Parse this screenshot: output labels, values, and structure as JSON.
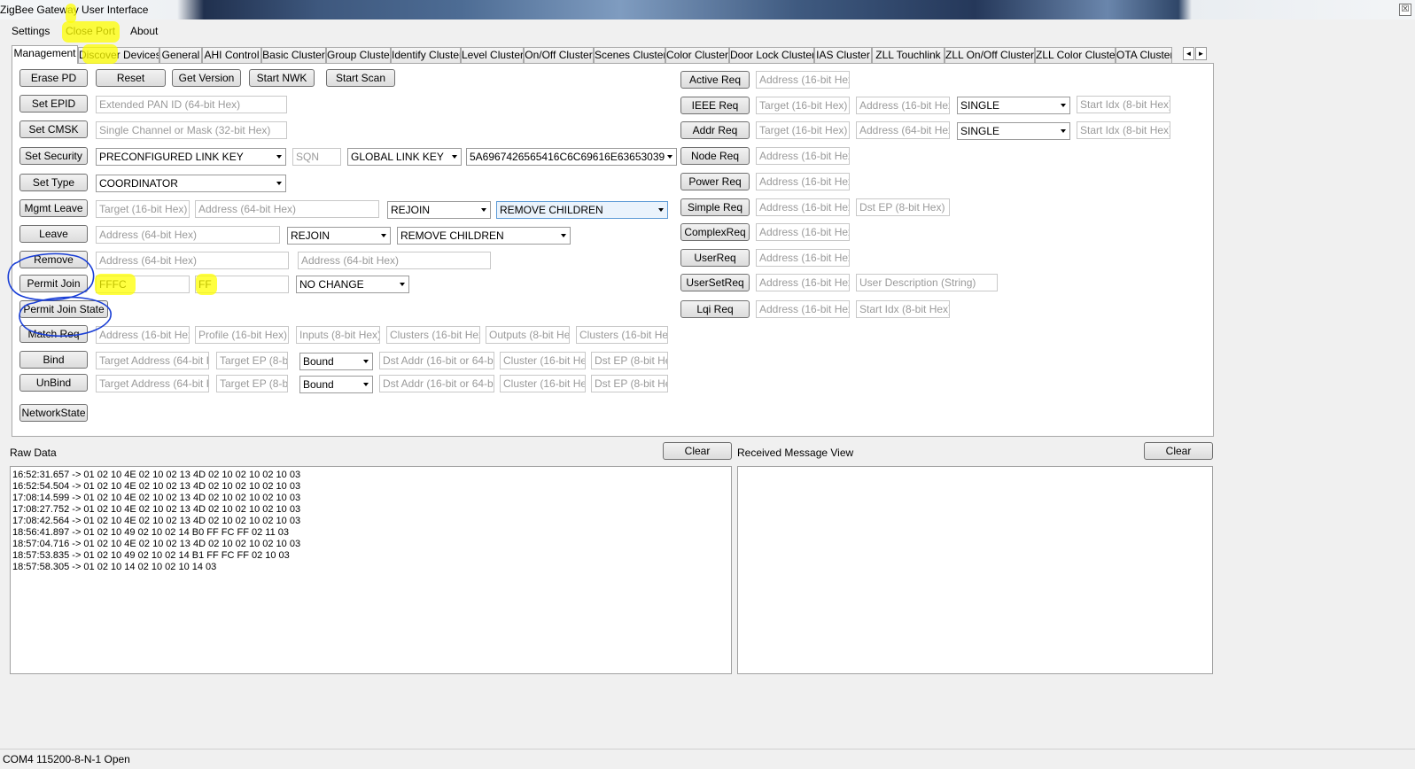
{
  "window": {
    "title": "ZigBee Gateway User Interface",
    "close_glyph": "☒"
  },
  "menu": {
    "items": [
      "Settings",
      "Close Port",
      "About"
    ]
  },
  "tabs": {
    "items": [
      "Management",
      "Discover Devices",
      "General",
      "AHI Control",
      "Basic Cluster",
      "Group Cluster",
      "Identify Cluster",
      "Level Cluster",
      "On/Off Cluster",
      "Scenes Cluster",
      "Color Cluster",
      "Door Lock Cluster",
      "IAS Cluster",
      "ZLL Touchlink",
      "ZLL On/Off Cluster",
      "ZLL Color Cluster",
      "OTA Cluster"
    ],
    "active": "Management",
    "scroll_left": "◄",
    "scroll_right": "►"
  },
  "left": {
    "erase_pd": "Erase PD",
    "reset": "Reset",
    "get_version": "Get Version",
    "start_nwk": "Start NWK",
    "start_scan": "Start Scan",
    "set_epid": "Set EPID",
    "epid_placeholder": "Extended PAN ID (64-bit Hex)",
    "set_cmsk": "Set CMSK",
    "cmsk_placeholder": "Single Channel or Mask (32-bit Hex)",
    "set_security": "Set Security",
    "security_type": "PRECONFIGURED LINK KEY",
    "sqn_placeholder": "SQN",
    "key_type": "GLOBAL LINK KEY",
    "key_value": "5A6967426565416C6C69616E63653039",
    "set_type": "Set Type",
    "device_type": "COORDINATOR",
    "mgmt_leave": "Mgmt Leave",
    "mgmt_leave_target": "Target (16-bit Hex)",
    "mgmt_leave_address": "Address (64-bit Hex)",
    "mgmt_leave_rejoin": "REJOIN",
    "mgmt_leave_children": "REMOVE CHILDREN",
    "leave": "Leave",
    "leave_address": "Address (64-bit Hex)",
    "leave_rejoin": "REJOIN",
    "leave_children": "REMOVE CHILDREN",
    "remove": "Remove",
    "remove_address1": "Address (64-bit Hex)",
    "remove_address2": "Address (64-bit Hex)",
    "permit_join": "Permit Join",
    "permit_join_target": "FFFC",
    "permit_join_duration": "FF",
    "permit_join_tc": "NO CHANGE",
    "permit_join_state": "Permit Join State",
    "match_req": "Match Req",
    "match_address": "Address (16-bit Hex)",
    "match_profile": "Profile (16-bit Hex)",
    "match_inputs": "Inputs (8-bit Hex)",
    "match_in_clusters": "Clusters (16-bit Hex)",
    "match_outputs": "Outputs (8-bit Hex)",
    "match_out_clusters": "Clusters (16-bit Hex)",
    "bind": "Bind",
    "bind_target": "Target Address (64-bit Hex)",
    "bind_target_ep": "Target EP (8-bit",
    "bind_mode": "Bound",
    "bind_dst": "Dst Addr (16-bit or 64-bit He",
    "bind_cluster": "Cluster (16-bit Hex)",
    "bind_dst_ep": "Dst EP (8-bit Hex)",
    "unbind": "UnBind",
    "unbind_target": "Target Address (64-bit Hex)",
    "unbind_target_ep": "Target EP (8-bit",
    "unbind_mode": "Bound",
    "unbind_dst": "Dst Addr (16-bit or 64-bit He",
    "unbind_cluster": "Cluster (16-bit Hex)",
    "unbind_dst_ep": "Dst EP (8-bit Hex)",
    "network_state": "NetworkState"
  },
  "right": {
    "active_req": "Active Req",
    "active_address": "Address (16-bit Hex)",
    "ieee_req": "IEEE Req",
    "ieee_target": "Target (16-bit Hex)",
    "ieee_address": "Address (16-bit Hex)",
    "ieee_mode": "SINGLE",
    "ieee_start": "Start Idx (8-bit Hex)",
    "addr_req": "Addr Req",
    "addr_target": "Target (16-bit Hex)",
    "addr_address": "Address (64-bit Hex)",
    "addr_mode": "SINGLE",
    "addr_start": "Start Idx (8-bit Hex)",
    "node_req": "Node Req",
    "node_address": "Address (16-bit Hex)",
    "power_req": "Power Req",
    "power_address": "Address (16-bit Hex)",
    "simple_req": "Simple Req",
    "simple_address": "Address (16-bit Hex)",
    "simple_dst_ep": "Dst EP (8-bit Hex)",
    "complex_req": "ComplexReq",
    "complex_address": "Address (16-bit Hex)",
    "user_req": "UserReq",
    "user_address": "Address (16-bit Hex)",
    "user_set_req": "UserSetReq",
    "user_set_address": "Address (16-bit Hex)",
    "user_set_desc": "User Description (String)",
    "lqi_req": "Lqi Req",
    "lqi_address": "Address (16-bit Hex)",
    "lqi_start": "Start Idx (8-bit Hex)"
  },
  "raw": {
    "label": "Raw Data",
    "clear": "Clear",
    "lines": [
      "16:52:31.657 -> 01 02 10 4E 02 10 02 13 4D 02 10 02 10 02 10 03",
      "16:52:54.504 -> 01 02 10 4E 02 10 02 13 4D 02 10 02 10 02 10 03",
      "17:08:14.599 -> 01 02 10 4E 02 10 02 13 4D 02 10 02 10 02 10 03",
      "17:08:27.752 -> 01 02 10 4E 02 10 02 13 4D 02 10 02 10 02 10 03",
      "17:08:42.564 -> 01 02 10 4E 02 10 02 13 4D 02 10 02 10 02 10 03",
      "18:56:41.897 -> 01 02 10 49 02 10 02 14 B0 FF FC FF 02 11 03",
      "18:57:04.716 -> 01 02 10 4E 02 10 02 13 4D 02 10 02 10 02 10 03",
      "18:57:53.835 -> 01 02 10 49 02 10 02 14 B1 FF FC FF 02 10 03",
      "18:57:58.305 -> 01 02 10 14 02 10 02 10 14 03"
    ]
  },
  "received": {
    "label": "Received Message View",
    "clear": "Clear"
  },
  "status": {
    "text": "COM4 115200-8-N-1 Open"
  },
  "colors": {
    "highlight": "#ffff00",
    "ink": "#1a3fd6"
  }
}
